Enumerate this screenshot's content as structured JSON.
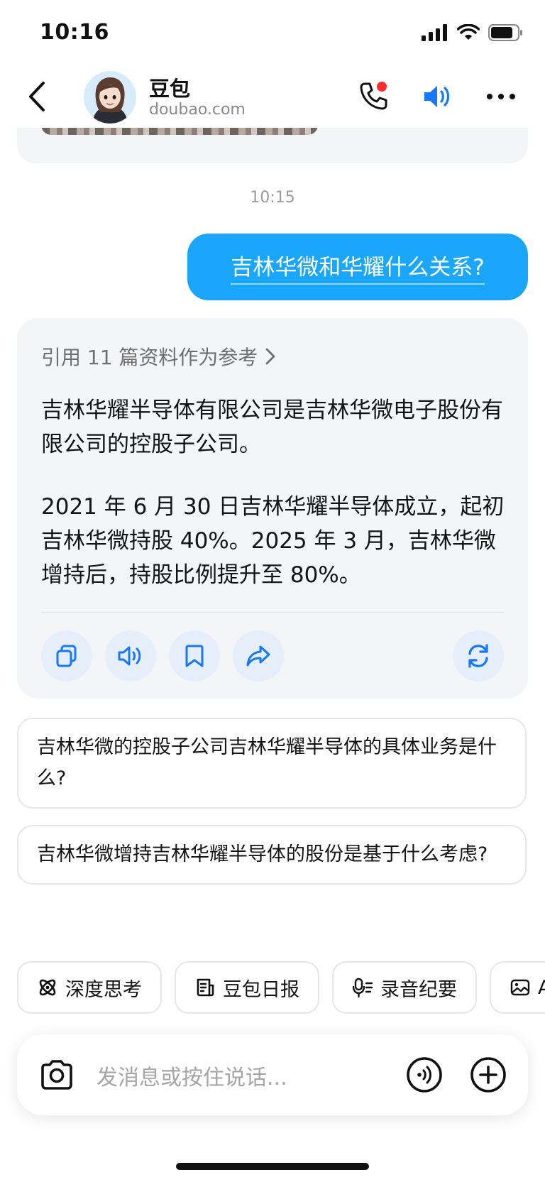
{
  "status": {
    "time": "10:16"
  },
  "header": {
    "name": "豆包",
    "domain": "doubao.com"
  },
  "chat": {
    "timestamp": "10:15",
    "user_message": "吉林华微和华耀什么关系?",
    "answer": {
      "reference_label": "引用 11 篇资料作为参考",
      "paragraphs": [
        "吉林华耀半导体有限公司是吉林华微电子股份有限公司的控股子公司。",
        "2021 年 6 月 30 日吉林华耀半导体成立，起初吉林华微持股 40%。2025 年 3 月，吉林华微增持后，持股比例提升至 80%。"
      ]
    },
    "suggestions": [
      "吉林华微的控股子公司吉林华耀半导体的具体业务是什么?",
      "吉林华微增持吉林华耀半导体的股份是基于什么考虑?"
    ]
  },
  "chips": [
    "深度思考",
    "豆包日报",
    "录音纪要",
    "A"
  ],
  "input": {
    "placeholder": "发消息或按住说话..."
  },
  "colors": {
    "accent": "#1aa6fb",
    "icon_blue": "#1677ff",
    "notification": "#ff2d2d"
  },
  "icons": [
    "back-icon",
    "phone-icon",
    "speaker-icon",
    "more-icon",
    "copy-icon",
    "read-aloud-icon",
    "bookmark-icon",
    "share-icon",
    "regenerate-icon",
    "atom-icon",
    "report-icon",
    "mic-notes-icon",
    "image-icon",
    "camera-icon",
    "voice-icon",
    "plus-icon"
  ]
}
